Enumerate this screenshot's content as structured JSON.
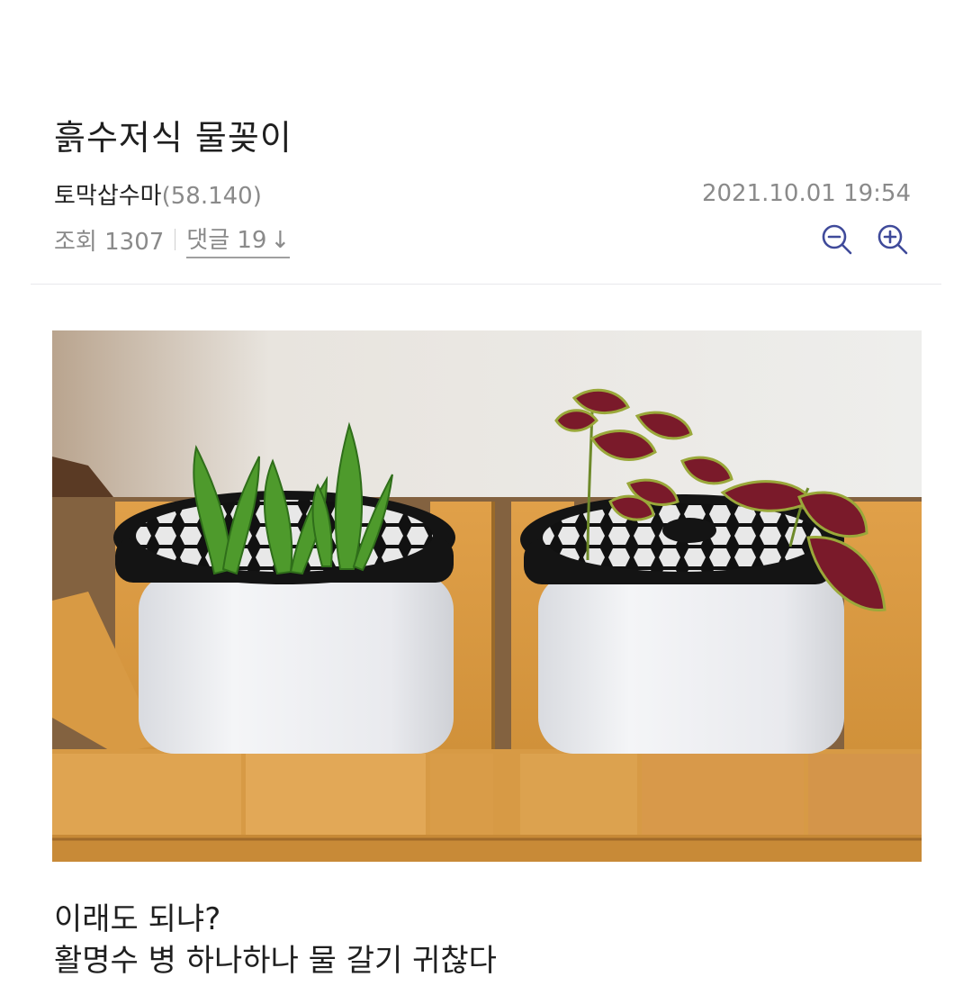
{
  "post": {
    "title": "흙수저식 물꽂이",
    "author": "토막삽수마",
    "author_score": "(58.140)",
    "date": "2021.10.01 19:54",
    "views_label": "조회 1307",
    "comments_label": "댓글 19",
    "comments_arrow": "↓",
    "body_lines": [
      "이래도 되냐?",
      "활명수 병 하나하나 물 갈기 귀찮다"
    ]
  },
  "icons": {
    "zoom_out": "zoom-out-icon",
    "zoom_in": "zoom-in-icon"
  },
  "colors": {
    "accent": "#3f4a9a",
    "muted": "#8a8a8a",
    "text": "#222222"
  }
}
